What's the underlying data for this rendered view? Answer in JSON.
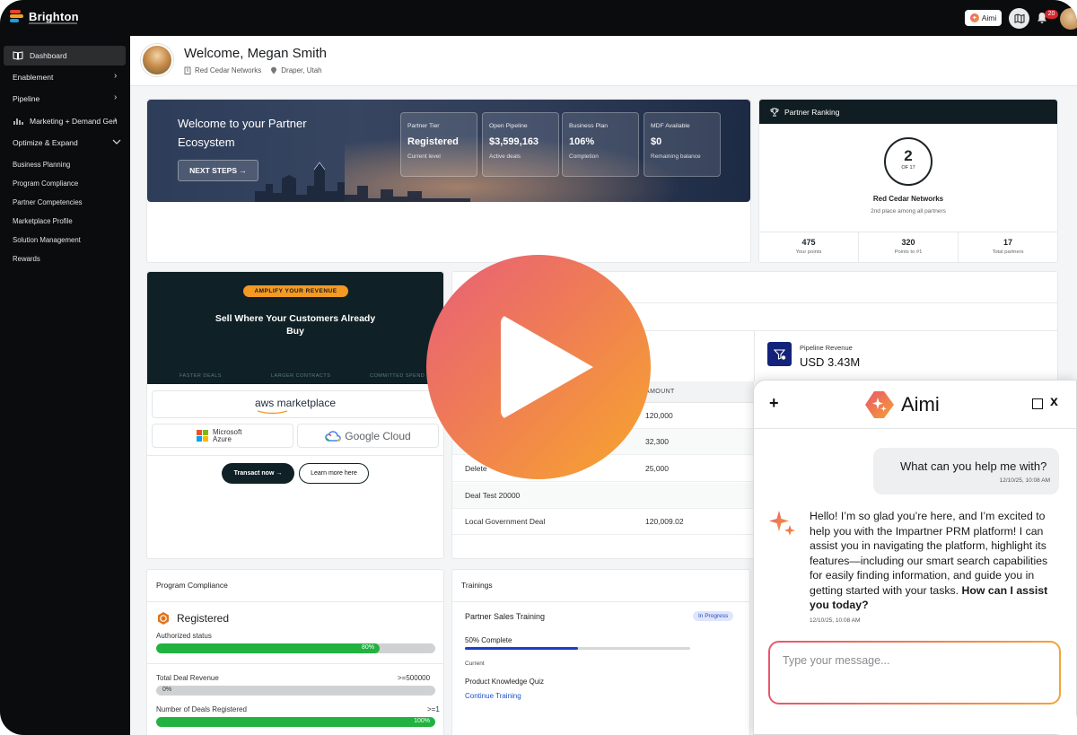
{
  "brand": {
    "name": "Brighton"
  },
  "topbar": {
    "aimi_label": "Aimi",
    "notification_count": "20"
  },
  "sidebar": {
    "items": [
      {
        "label": "Dashboard"
      },
      {
        "label": "Enablement"
      },
      {
        "label": "Pipeline"
      },
      {
        "label": "Marketing + Demand Gen"
      },
      {
        "label": "Optimize & Expand"
      }
    ],
    "sub_items": [
      "Business Planning",
      "Program Compliance",
      "Partner Competencies",
      "Marketplace Profile",
      "Solution Management",
      "Rewards"
    ]
  },
  "header": {
    "welcome": "Welcome, Megan Smith",
    "company": "Red Cedar Networks",
    "location": "Draper, Utah"
  },
  "hero": {
    "title": "Welcome to your Partner Ecosystem",
    "next_steps": "NEXT STEPS →",
    "tiles": [
      {
        "label": "Partner Tier",
        "value": "Registered",
        "sub": "Current level"
      },
      {
        "label": "Open Pipeline",
        "value": "$3,599,163",
        "sub": "Active deals"
      },
      {
        "label": "Business Plan",
        "value": "106%",
        "sub": "Completion"
      },
      {
        "label": "MDF Available",
        "value": "$0",
        "sub": "Remaining balance"
      }
    ]
  },
  "ranking": {
    "title": "Partner Ranking",
    "rank": "2",
    "of": "OF 17",
    "company": "Red Cedar Networks",
    "subtitle": "2nd place among all partners",
    "stats": [
      {
        "value": "475",
        "label": "Your points"
      },
      {
        "value": "320",
        "label": "Points to #1"
      },
      {
        "value": "17",
        "label": "Total partners"
      }
    ]
  },
  "amplify": {
    "pill": "AMPLIFY YOUR REVENUE",
    "title": "Sell Where Your Customers Already Buy",
    "footer": [
      "FASTER DEALS",
      "LARGER CONTRACTS",
      "COMMITTED SPEND"
    ],
    "logos": {
      "aws": "aws marketplace",
      "microsoft": "Microsoft Azure",
      "google": "Google Cloud"
    },
    "transact_label": "Transact now →",
    "learn_label": "Learn more here"
  },
  "pipeline": {
    "revenue_label": "Pipeline Revenue",
    "revenue_value": "USD 3.43M",
    "amount_header": "AMOUNT",
    "rows": [
      {
        "name": "",
        "amount": "120,000"
      },
      {
        "name": "",
        "amount": "32,300"
      },
      {
        "name": "Delete",
        "amount": "25,000"
      },
      {
        "name": "Deal Test 20000",
        "amount": ""
      },
      {
        "name": "Local Government Deal",
        "amount": "120,009.02"
      }
    ]
  },
  "compliance": {
    "title": "Program Compliance",
    "tier": "Registered",
    "status_label": "Authorized status",
    "status_pct": "80%",
    "status_value": 0.8,
    "revenue_label": "Total Deal Revenue",
    "revenue_target": ">=500000",
    "revenue_pct": "0%",
    "revenue_value": 0,
    "deals_label": "Number of Deals Registered",
    "deals_target": ">=1",
    "deals_pct": "100%",
    "deals_value": 1
  },
  "trainings": {
    "title": "Trainings",
    "course": "Partner Sales Training",
    "badge": "In Progress",
    "progress_text": "50% Complete",
    "progress_value": 0.5,
    "current_label": "Current",
    "next_course": "Product Knowledge Quiz",
    "continue_label": "Continue Training"
  },
  "aimi": {
    "name": "Aimi",
    "plus": "+",
    "close": "x",
    "user_message": "What can you help me with?",
    "user_time": "12/10/25, 10:08 AM",
    "bot_message": "Hello! I’m so glad you’re here, and I’m excited to help you with the Impartner PRM platform! I can assist you in navigating the platform, highlight its features—including our smart search capabilities for easily finding information, and guide you in getting started with your tasks.",
    "bot_message_bold": "How can I assist you today?",
    "bot_time": "12/10/25, 10:08 AM",
    "input_placeholder": "Type your message..."
  },
  "colors": {
    "sidebar": "#0b0c0d",
    "accent_orange": "#f29a24",
    "progress_green": "#21b240",
    "training_blue": "#1c3ec7",
    "play_start": "#e85f78",
    "play_end": "#f7a62d"
  }
}
